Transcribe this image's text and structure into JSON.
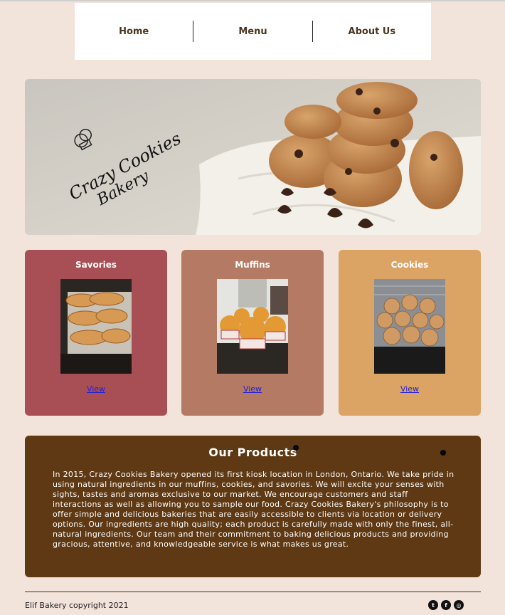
{
  "nav": {
    "items": [
      {
        "label": "Home"
      },
      {
        "label": "Menu"
      },
      {
        "label": "About Us"
      }
    ]
  },
  "hero": {
    "logo_line1": "Crazy Cookies",
    "logo_line2": "Bakery"
  },
  "cards": [
    {
      "title": "Savories",
      "link": "View",
      "color": "#a84f55"
    },
    {
      "title": "Muffins",
      "link": "View",
      "color": "#b57a64"
    },
    {
      "title": "Cookies",
      "link": "View",
      "color": "#dba364"
    }
  ],
  "products": {
    "title": "Our Products",
    "body": "In 2015, Crazy Cookies Bakery opened its first kiosk location in London, Ontario. We take pride in using natural ingredients in our muffins, cookies, and savories. We will excite your senses with sights, tastes and aromas exclusive to our market. We encourage customers and staff interactions as well as allowing you to sample our food. Crazy Cookies Bakery's philosophy is to offer simple and delicious bakeries that are easily accessible to clients via location or delivery options. Our ingredients are high quality; each product is carefully made with only the finest, all-natural ingredients. Our team and their commitment to baking delicious products and providing gracious, attentive, and knowledgeable service is what makes us great."
  },
  "footer": {
    "copyright": "Elif Bakery copyright 2021",
    "social_icons": [
      "twitter-icon",
      "facebook-icon",
      "instagram-icon"
    ]
  }
}
